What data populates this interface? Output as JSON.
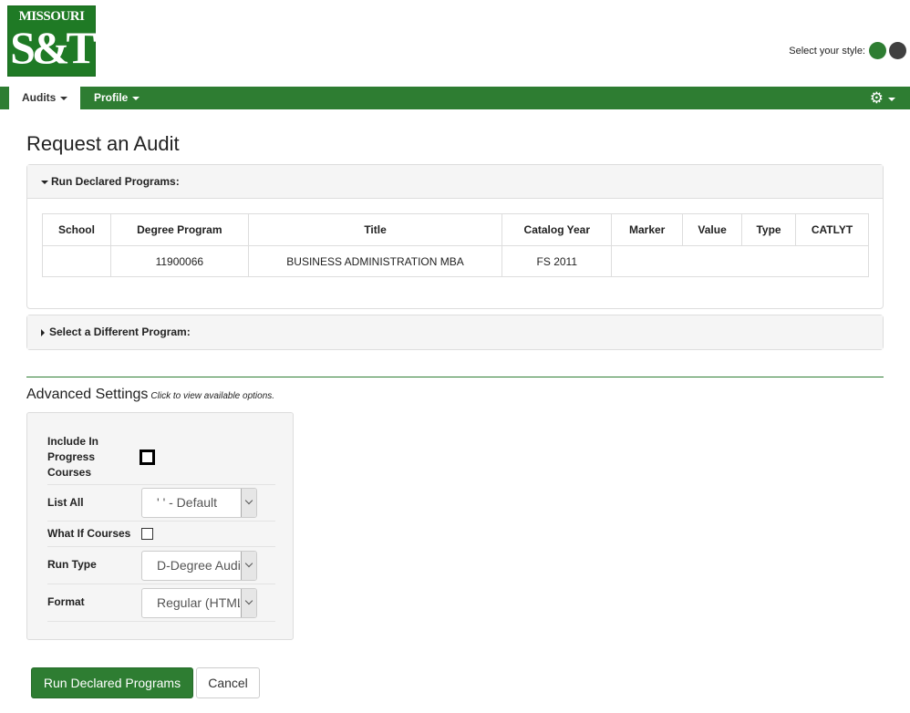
{
  "logo": {
    "top_text": "MISSOURI",
    "main_text": "S&T"
  },
  "style_picker": {
    "label": "Select your style:",
    "swatches": [
      {
        "name": "green",
        "color": "#2e7d32"
      },
      {
        "name": "dark",
        "color": "#404040"
      }
    ]
  },
  "nav": {
    "tabs": [
      {
        "label": "Audits",
        "active": true
      },
      {
        "label": "Profile",
        "active": false
      }
    ],
    "settings_icon": "gear-icon"
  },
  "page": {
    "title": "Request an Audit"
  },
  "declared_panel": {
    "heading": "Run Declared Programs:",
    "columns": [
      "School",
      "Degree Program",
      "Title",
      "Catalog Year",
      "Marker",
      "Value",
      "Type",
      "CATLYT"
    ],
    "rows": [
      {
        "school": "",
        "degree_program": "11900066",
        "title": "BUSINESS ADMINISTRATION MBA",
        "catalog_year": "FS 2011",
        "marker": ""
      }
    ]
  },
  "different_panel": {
    "heading": "Select a Different Program:"
  },
  "advanced": {
    "title": "Advanced Settings",
    "hint": "Click to view available options.",
    "include_in_progress": {
      "label_lines": [
        "Include In",
        "Progress",
        "Courses"
      ],
      "checked": false
    },
    "list_all": {
      "label": "List All",
      "value": "' ' - Default"
    },
    "what_if": {
      "label": "What If Courses",
      "checked": false
    },
    "run_type": {
      "label": "Run Type",
      "value": "D-Degree Audit"
    },
    "format": {
      "label": "Format",
      "value": "Regular (HTML)"
    }
  },
  "buttons": {
    "run": "Run Declared Programs",
    "cancel": "Cancel"
  },
  "colors": {
    "brand_green": "#2e7d32",
    "panel_bg": "#f5f5f5"
  }
}
